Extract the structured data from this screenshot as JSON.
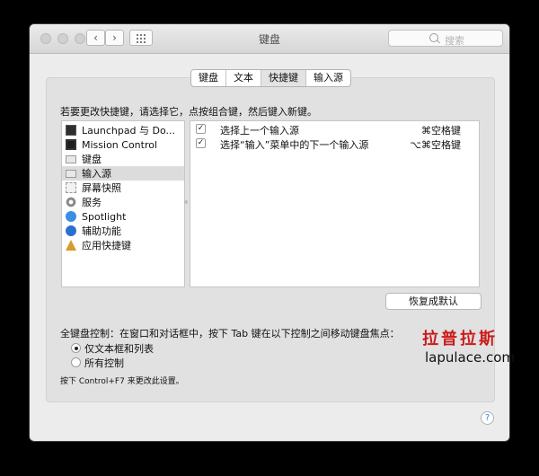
{
  "window": {
    "title": "键盘"
  },
  "search": {
    "placeholder": "搜索"
  },
  "tabs": [
    {
      "label": "键盘",
      "active": false
    },
    {
      "label": "文本",
      "active": false
    },
    {
      "label": "快捷键",
      "active": true
    },
    {
      "label": "输入源",
      "active": false
    }
  ],
  "instruction": "若要更改快捷键，请选择它，点按组合键，然后键入新键。",
  "categories": [
    {
      "label": "Launchpad 与 Do...",
      "icon": "launchpad-icon"
    },
    {
      "label": "Mission Control",
      "icon": "mission-control-icon"
    },
    {
      "label": "键盘",
      "icon": "keyboard-icon"
    },
    {
      "label": "输入源",
      "icon": "input-source-icon",
      "selected": true
    },
    {
      "label": "屏幕快照",
      "icon": "screenshot-icon"
    },
    {
      "label": "服务",
      "icon": "gear-icon"
    },
    {
      "label": "Spotlight",
      "icon": "spotlight-icon"
    },
    {
      "label": "辅助功能",
      "icon": "accessibility-icon"
    },
    {
      "label": "应用快捷键",
      "icon": "app-shortcuts-icon"
    }
  ],
  "shortcuts": [
    {
      "checked": true,
      "name": "选择上一个输入源",
      "key": "⌘空格键"
    },
    {
      "checked": true,
      "name": "选择“输入”菜单中的下一个输入源",
      "key": "⌥⌘空格键"
    }
  ],
  "restore_button": "恢复成默认",
  "keyboard_control": {
    "label": "全键盘控制：在窗口和对话框中，按下 Tab 键在以下控制之间移动键盘焦点：",
    "options": [
      {
        "label": "仅文本框和列表",
        "selected": true
      },
      {
        "label": "所有控制",
        "selected": false
      }
    ]
  },
  "hint": "按下 Control+F7 来更改此设置。",
  "help": "?",
  "watermark": {
    "chinese": "拉普拉斯",
    "url": "lapulace.com"
  },
  "colors": {
    "watermark_red": "#cc1a1a",
    "help_blue": "#3b7de2"
  }
}
